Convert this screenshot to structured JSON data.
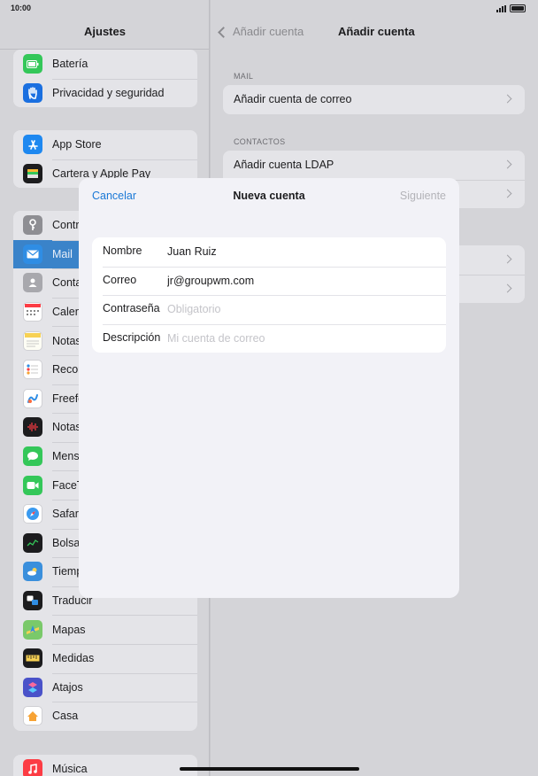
{
  "status": {
    "time": "10:00"
  },
  "sidebar": {
    "title": "Ajustes",
    "groups": [
      [
        {
          "label": "Batería",
          "icon": "battery-icon",
          "color": "#34c759"
        },
        {
          "label": "Privacidad y seguridad",
          "icon": "hand-icon",
          "color": "#1a6fe0"
        }
      ],
      [
        {
          "label": "App Store",
          "icon": "app-store-icon",
          "color": "#1e88f0"
        },
        {
          "label": "Cartera y Apple Pay",
          "icon": "wallet-icon",
          "color": "#1c1c1e"
        }
      ],
      [
        {
          "label": "Contr",
          "icon": "key-icon",
          "color": "#8e8e93"
        },
        {
          "label": "Mail",
          "icon": "mail-icon",
          "color": "#2f8de4",
          "selected": true
        },
        {
          "label": "Conta",
          "icon": "contacts-icon",
          "color": "#a8a8ad"
        },
        {
          "label": "Calen",
          "icon": "calendar-icon",
          "color": "#ffffff"
        },
        {
          "label": "Notas",
          "icon": "notes-icon",
          "color": "#f7d154"
        },
        {
          "label": "Recor",
          "icon": "reminders-icon",
          "color": "#ffffff"
        },
        {
          "label": "Freefo",
          "icon": "freeform-icon",
          "color": "#ffffff"
        },
        {
          "label": "Notas",
          "icon": "voice-memos-icon",
          "color": "#1c1c1e"
        },
        {
          "label": "Mens",
          "icon": "messages-icon",
          "color": "#34c759"
        },
        {
          "label": "FaceT",
          "icon": "facetime-icon",
          "color": "#34c759"
        },
        {
          "label": "Safar",
          "icon": "safari-icon",
          "color": "#2f8de4"
        },
        {
          "label": "Bolsa",
          "icon": "stocks-icon",
          "color": "#1c1c1e"
        },
        {
          "label": "Tiemp",
          "icon": "weather-icon",
          "color": "#3a8fdc"
        },
        {
          "label": "Traducir",
          "icon": "translate-icon",
          "color": "#1c1c1e"
        },
        {
          "label": "Mapas",
          "icon": "maps-icon",
          "color": "#7ac96a"
        },
        {
          "label": "Medidas",
          "icon": "measure-icon",
          "color": "#1c1c1e"
        },
        {
          "label": "Atajos",
          "icon": "shortcuts-icon",
          "color": "#4a52c9"
        },
        {
          "label": "Casa",
          "icon": "home-icon",
          "color": "#ffffff"
        }
      ],
      [
        {
          "label": "Música",
          "icon": "music-icon",
          "color": "#fc3c44"
        }
      ]
    ]
  },
  "detail": {
    "back_label": "Añadir cuenta",
    "title": "Añadir cuenta",
    "sections": [
      {
        "header": "MAIL",
        "rows": [
          "Añadir cuenta de correo"
        ]
      },
      {
        "header": "CONTACTOS",
        "rows": [
          "Añadir cuenta LDAP",
          ""
        ]
      },
      {
        "header": "",
        "rows": [
          "",
          ""
        ]
      }
    ]
  },
  "modal": {
    "cancel_label": "Cancelar",
    "title": "Nueva cuenta",
    "next_label": "Siguiente",
    "fields": {
      "name": {
        "label": "Nombre",
        "value": "Juan Ruiz",
        "placeholder": ""
      },
      "email": {
        "label": "Correo",
        "value": "jr@groupwm.com",
        "placeholder": ""
      },
      "password": {
        "label": "Contraseña",
        "value": "",
        "placeholder": "Obligatorio"
      },
      "description": {
        "label": "Descripción",
        "value": "",
        "placeholder": "Mi cuenta de correo"
      }
    }
  }
}
